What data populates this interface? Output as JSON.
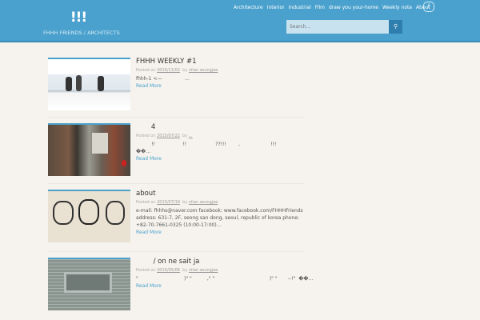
{
  "header": {
    "logo": "!!!",
    "subtitle": "FHHH FRIENDS / ARCHITECTS",
    "nav": [
      "Architecture",
      "Interior",
      "Industrial",
      "Film",
      "draw you your-home",
      "Weekly note",
      "About"
    ],
    "facebook_icon": "f",
    "search_placeholder": "Search...",
    "search_icon": "search-icon"
  },
  "posts": [
    {
      "title": "FHHH WEEKLY #1",
      "posted_on": "Posted on",
      "date": "2015/11/02",
      "by": "by",
      "author": "nilan seungjae",
      "excerpt": "fhhh-1 <—               ...",
      "more": "Read More"
    },
    {
      "title": "       4",
      "posted_on": "Posted on",
      "date": "2015/07/22",
      "by": "by",
      "author": "...",
      "excerpt": "          !!                  !!                   ??!!!        ,                    !!!\n��...",
      "more": "Read More"
    },
    {
      "title": "about",
      "posted_on": "Posted on",
      "date": "2015/07/19",
      "by": "by",
      "author": "nilan seungjae",
      "excerpt": "e-mail: fhhhs@naver.com facebook: www.facebook.com/FHHHFriends address: 631-7, 2F, seong san dong, seoul, republic of korea phone: +82-70-7661-0325 (10:00-17:00)...",
      "more": "Read More"
    },
    {
      "title": "        / on ne sait ja",
      "posted_on": "Posted on",
      "date": "2015/05/06",
      "by": "by",
      "author": "nilan seungjae",
      "excerpt": "\"                              )\" \"          ,\" \"                                    )\" \"       --!\"  ��...",
      "more": "Read More"
    }
  ]
}
